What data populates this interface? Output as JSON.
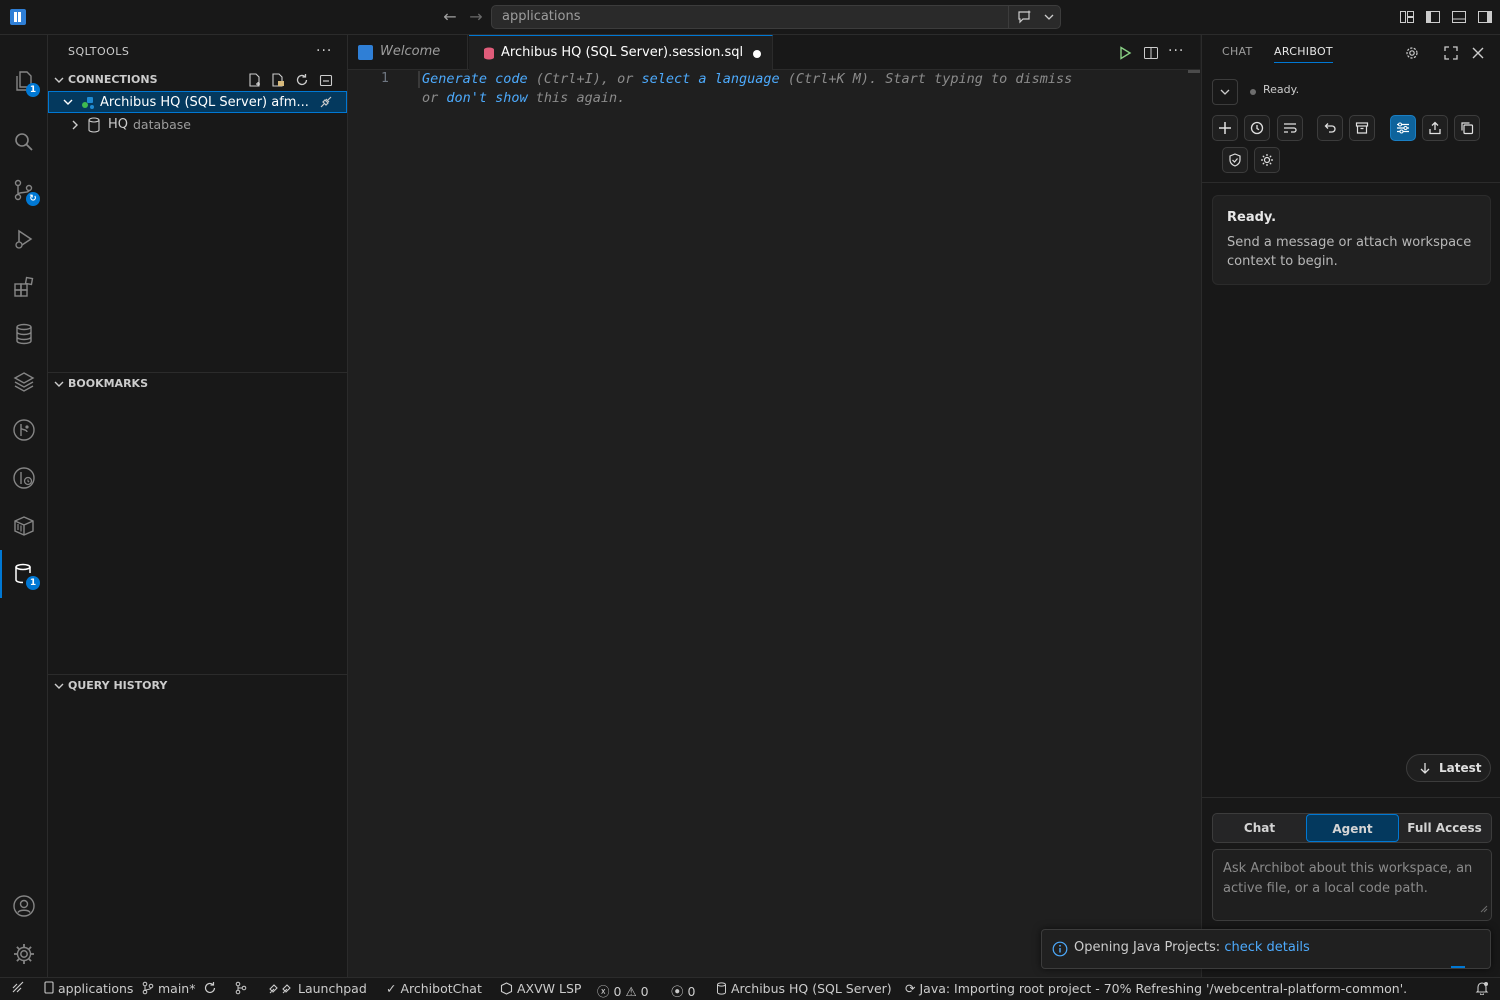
{
  "titlebar": {
    "search_text": "applications"
  },
  "activitybar": {
    "explorer_badge": "1",
    "sqltools_badge": "1"
  },
  "sidebar": {
    "title": "SQLTOOLS",
    "more": "···",
    "connections_title": "CONNECTIONS",
    "connection_label": "Archibus HQ (SQL Server)  afm...",
    "db_name": "HQ",
    "db_type": "database",
    "bookmarks_title": "BOOKMARKS",
    "history_title": "QUERY HISTORY"
  },
  "editor": {
    "tabs": [
      {
        "label": "Welcome"
      },
      {
        "label": "Archibus HQ (SQL Server).session.sql"
      }
    ],
    "line_number": "1",
    "hint": {
      "generate": "Generate code",
      "p1": " (Ctrl+I), or ",
      "select": "select a language",
      "p2": " (Ctrl+K M). Start typing to dismiss",
      "p3": "or ",
      "dont": "don't show",
      "p4": " this again."
    }
  },
  "panel": {
    "tabs": [
      "CHAT",
      "ARCHIBOT"
    ],
    "status": "Ready.",
    "card_title": "Ready.",
    "card_text": "Send a message or attach workspace context to begin.",
    "latest": "Latest",
    "modes": [
      "Chat",
      "Agent",
      "Full Access"
    ],
    "input_placeholder": "Ask Archibot about this workspace, an active file, or a local code path."
  },
  "notification": {
    "text": "Opening Java Projects: ",
    "link": "check details"
  },
  "statusbar": {
    "folder": "applications",
    "branch": "main*",
    "launchpad": "Launchpad",
    "archibotchat": "ArchibotChat",
    "lsp": "AXVW LSP",
    "errors": "0",
    "warnings": "0",
    "ports": "0",
    "connection": "Archibus HQ (SQL Server)",
    "java_status": "Java: Importing root project - 70% Refreshing '/webcentral-platform-common'."
  },
  "colors": {
    "accent": "#0078d4",
    "link": "#4daafc",
    "sql_icon": "#e05c7a"
  }
}
